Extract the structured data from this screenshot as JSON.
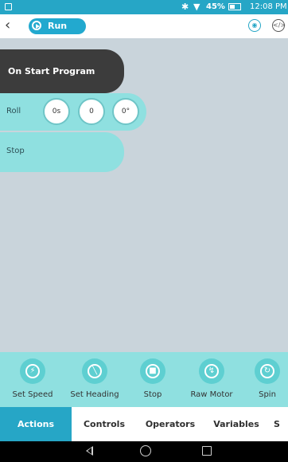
{
  "status_bar": {
    "battery_pct": "45%",
    "time": "12:08 PM",
    "icons": [
      "sim-icon",
      "bluetooth-icon",
      "wifi-icon",
      "battery-icon"
    ]
  },
  "toolbar": {
    "back_icon": "chevron-left-icon",
    "run_label": "Run",
    "right_icons": [
      "sphero-icon",
      "code-icon"
    ],
    "accent": "#26a6c6"
  },
  "canvas": {
    "start_block": {
      "label": "On Start Program"
    },
    "roll_block": {
      "label": "Roll",
      "params": [
        "0s",
        "0",
        "0°"
      ]
    },
    "stop_block": {
      "label": "Stop"
    },
    "block_color": "#8fe0e0",
    "start_color": "#3c3c3c"
  },
  "palette": {
    "items": [
      {
        "label": "Set Speed",
        "icon": "speedometer-icon"
      },
      {
        "label": "Set Heading",
        "icon": "compass-icon"
      },
      {
        "label": "Stop",
        "icon": "stop-icon"
      },
      {
        "label": "Raw Motor",
        "icon": "motor-icon"
      },
      {
        "label": "Spin",
        "icon": "spin-icon"
      }
    ]
  },
  "tabs": {
    "items": [
      "Actions",
      "Controls",
      "Operators",
      "Variables",
      "S"
    ],
    "active": "Actions"
  },
  "navbar": {
    "icons": [
      "back-triangle-icon",
      "home-circle-icon",
      "recent-apps-icon"
    ]
  }
}
